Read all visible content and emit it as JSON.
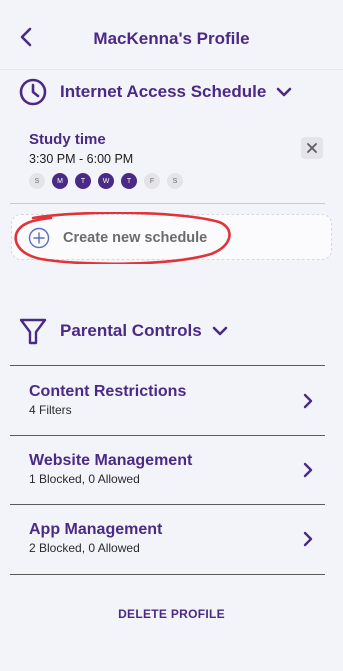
{
  "header": {
    "title": "MacKenna's Profile",
    "back_icon": "chevron-left-icon"
  },
  "internet_access": {
    "title": "Internet Access Schedule",
    "icon": "clock-icon",
    "schedule": {
      "name": "Study time",
      "time": "3:30 PM - 6:00 PM",
      "days": [
        {
          "label": "S",
          "active": false
        },
        {
          "label": "M",
          "active": true
        },
        {
          "label": "T",
          "active": true
        },
        {
          "label": "W",
          "active": true
        },
        {
          "label": "T",
          "active": true
        },
        {
          "label": "F",
          "active": false
        },
        {
          "label": "S",
          "active": false
        }
      ]
    },
    "create_label": "Create new schedule"
  },
  "parental_controls": {
    "title": "Parental Controls",
    "icon": "funnel-icon",
    "items": [
      {
        "title": "Content Restrictions",
        "subtitle": "4 Filters"
      },
      {
        "title": "Website Management",
        "subtitle": "1 Blocked, 0 Allowed"
      },
      {
        "title": "App Management",
        "subtitle": "2 Blocked, 0 Allowed"
      }
    ]
  },
  "delete_label": "DELETE PROFILE",
  "colors": {
    "accent": "#4b2a86",
    "annotation": "#e0333a",
    "background": "#f3f4fa"
  }
}
